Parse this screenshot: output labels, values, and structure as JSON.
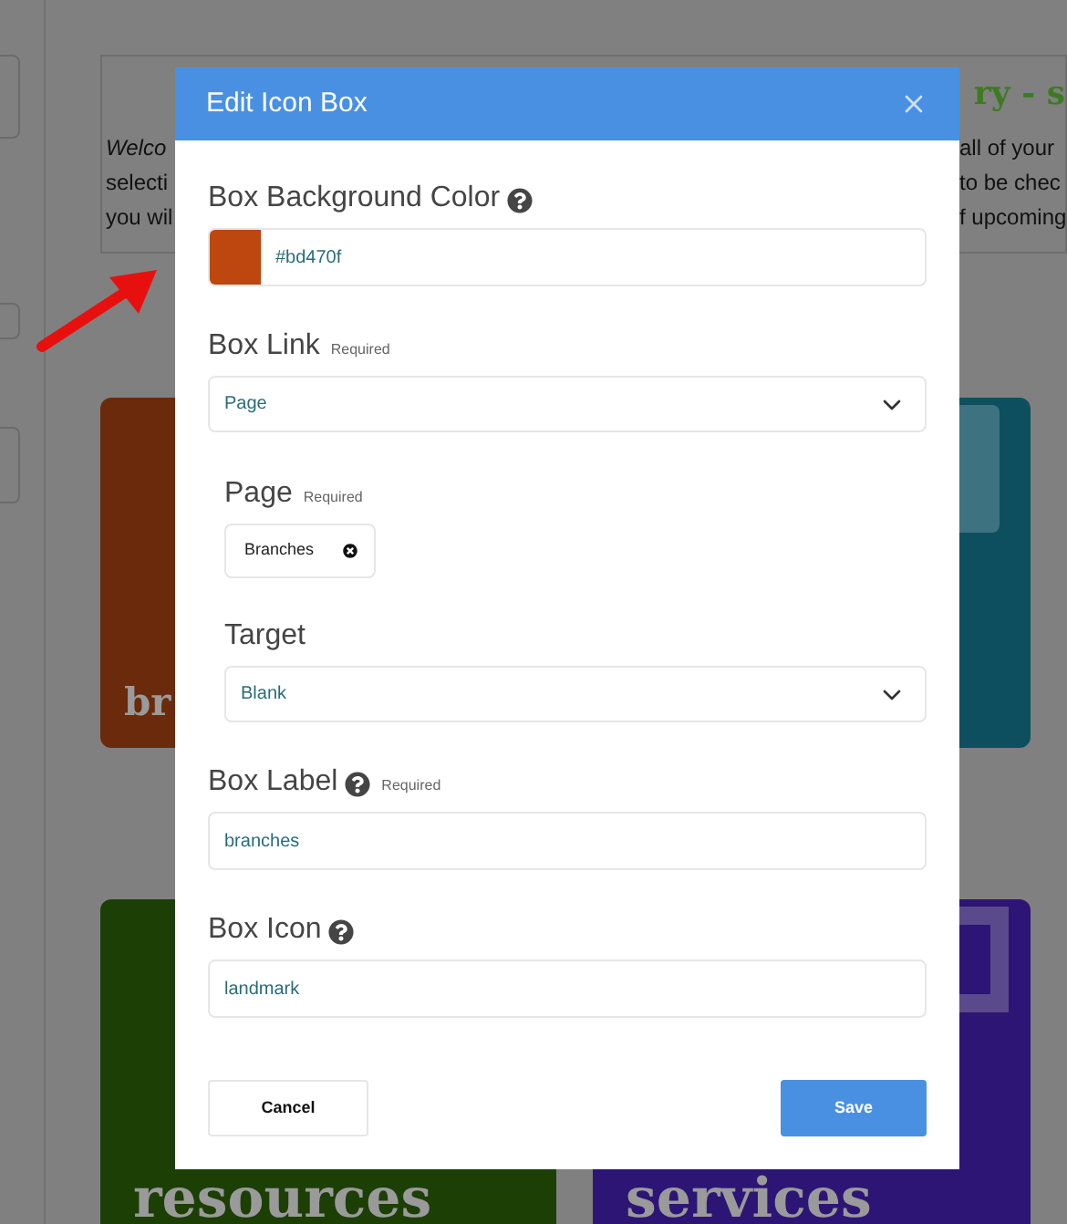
{
  "background": {
    "heading": "ry - s",
    "intro_left": [
      "Welco",
      "selecti",
      "you wil"
    ],
    "intro_right": [
      "all of your",
      "to be chec",
      "f upcoming"
    ],
    "cards": [
      {
        "label": "br",
        "color": "#6a2a0b"
      },
      {
        "color": "#0e4f5f"
      },
      {
        "label": "resources",
        "color": "#1c3f05"
      },
      {
        "label": "services",
        "color": "#2d1576"
      }
    ]
  },
  "modal": {
    "title": "Edit Icon Box",
    "fields": [
      {
        "kind": "color",
        "label": "Box Background Color",
        "help": true,
        "value": "#bd470f",
        "color": "#bd470f"
      },
      {
        "kind": "select",
        "label": "Box Link",
        "required": "Required",
        "value": "Page",
        "children": [
          {
            "kind": "tag",
            "label": "Page",
            "required": "Required",
            "value": "Branches"
          },
          {
            "kind": "select",
            "label": "Target",
            "value": "Blank"
          }
        ]
      },
      {
        "kind": "text",
        "label": "Box Label",
        "help": true,
        "required": "Required",
        "value": "branches"
      },
      {
        "kind": "text",
        "label": "Box Icon",
        "help": true,
        "value": "landmark"
      }
    ],
    "buttons": [
      {
        "kind": "secondary",
        "label": "Cancel"
      },
      {
        "kind": "primary",
        "label": "Save"
      }
    ]
  }
}
